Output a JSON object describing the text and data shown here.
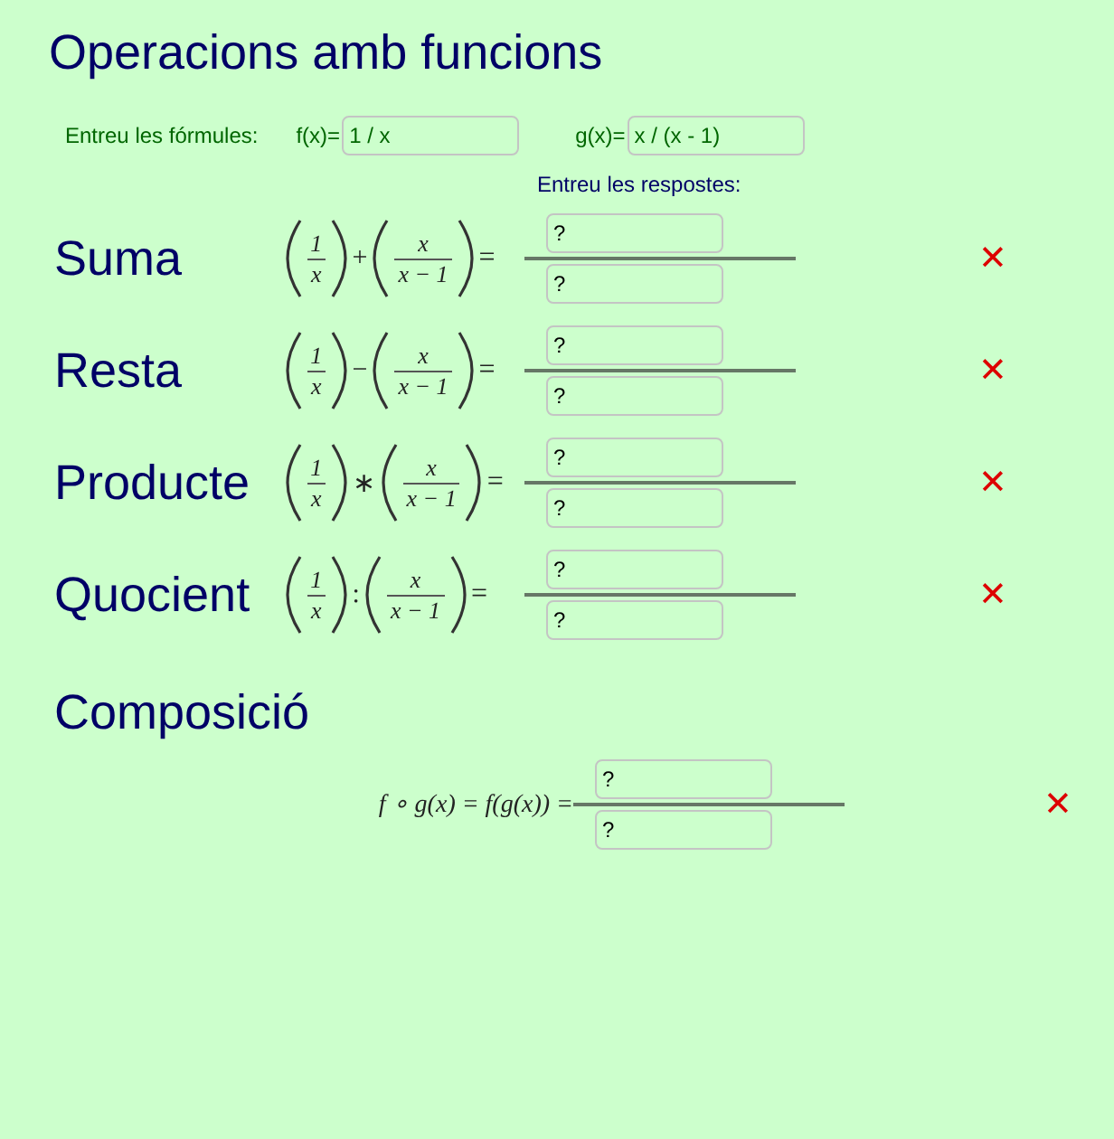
{
  "title": "Operacions amb funcions",
  "formulas": {
    "label": "Entreu les fórmules:",
    "f": {
      "label": "f(x)=",
      "value": "1 / x"
    },
    "g": {
      "label": "g(x)=",
      "value": "x / (x - 1)"
    }
  },
  "answers_label": "Entreu les respostes:",
  "operations": [
    {
      "kind": "fraction",
      "label": "Suma",
      "left": {
        "num": "1",
        "den": "x"
      },
      "op": "+",
      "right": {
        "num": "x",
        "den": "x − 1"
      },
      "equals": "=",
      "answer": {
        "numerator": {
          "placeholder": "?"
        },
        "denominator": {
          "placeholder": "?"
        }
      },
      "result": {
        "mark": "✕",
        "correct": false
      }
    },
    {
      "kind": "fraction",
      "label": "Resta",
      "left": {
        "num": "1",
        "den": "x"
      },
      "op": "−",
      "right": {
        "num": "x",
        "den": "x − 1"
      },
      "equals": "=",
      "answer": {
        "numerator": {
          "placeholder": "?"
        },
        "denominator": {
          "placeholder": "?"
        }
      },
      "result": {
        "mark": "✕",
        "correct": false
      }
    },
    {
      "kind": "fraction",
      "label": "Producte",
      "left": {
        "num": "1",
        "den": "x"
      },
      "op": "∗",
      "right": {
        "num": "x",
        "den": "x − 1"
      },
      "equals": "=",
      "answer": {
        "numerator": {
          "placeholder": "?"
        },
        "denominator": {
          "placeholder": "?"
        }
      },
      "result": {
        "mark": "✕",
        "correct": false
      }
    },
    {
      "kind": "fraction",
      "label": "Quocient",
      "left": {
        "num": "1",
        "den": "x"
      },
      "op": ":",
      "right": {
        "num": "x",
        "den": "x − 1"
      },
      "equals": "=",
      "answer": {
        "numerator": {
          "placeholder": "?"
        },
        "denominator": {
          "placeholder": "?"
        }
      },
      "result": {
        "mark": "✕",
        "correct": false
      }
    },
    {
      "kind": "composition",
      "label": "Composició",
      "formula": "f ∘ g(x) = f(g(x)) =",
      "answer": {
        "numerator": {
          "placeholder": "?"
        },
        "denominator": {
          "placeholder": "?"
        }
      },
      "result": {
        "mark": "✕",
        "correct": false
      }
    }
  ]
}
